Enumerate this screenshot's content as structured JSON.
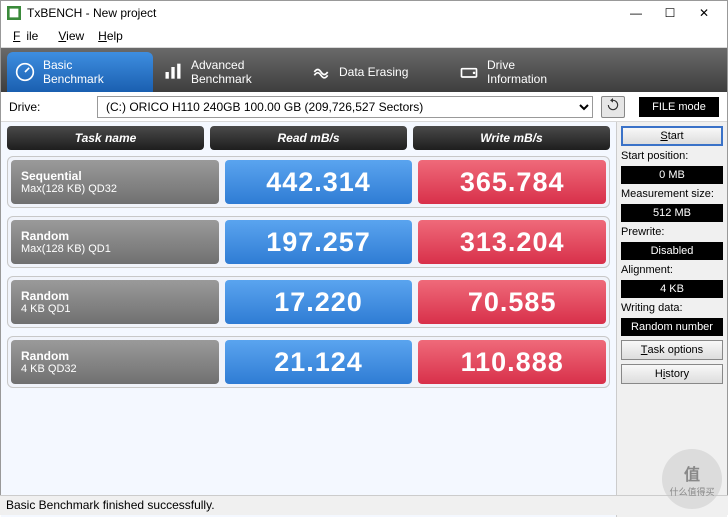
{
  "window": {
    "title": "TxBENCH - New project",
    "minimize": "—",
    "maximize": "☐",
    "close": "✕"
  },
  "menu": {
    "file": "File",
    "view": "View",
    "help": "Help"
  },
  "tabs": [
    {
      "id": "basic",
      "line1": "Basic",
      "line2": "Benchmark",
      "active": true
    },
    {
      "id": "advanced",
      "line1": "Advanced",
      "line2": "Benchmark",
      "active": false
    },
    {
      "id": "erase",
      "line1": "Data Erasing",
      "line2": "",
      "active": false
    },
    {
      "id": "drive",
      "line1": "Drive",
      "line2": "Information",
      "active": false
    }
  ],
  "drive": {
    "label": "Drive:",
    "selected": "(C:) ORICO H110 240GB  100.00 GB (209,726,527 Sectors)",
    "filemode": "FILE mode"
  },
  "headers": {
    "task": "Task name",
    "read": "Read mB/s",
    "write": "Write mB/s"
  },
  "tests": [
    {
      "name1": "Sequential",
      "name2": "Max(128 KB) QD32",
      "read": "442.314",
      "write": "365.784"
    },
    {
      "name1": "Random",
      "name2": "Max(128 KB) QD1",
      "read": "197.257",
      "write": "313.204"
    },
    {
      "name1": "Random",
      "name2": "4 KB QD1",
      "read": "17.220",
      "write": "70.585"
    },
    {
      "name1": "Random",
      "name2": "4 KB QD32",
      "read": "21.124",
      "write": "110.888"
    }
  ],
  "side": {
    "start": "Start",
    "startpos_label": "Start position:",
    "startpos": "0 MB",
    "msize_label": "Measurement size:",
    "msize": "512 MB",
    "prewrite_label": "Prewrite:",
    "prewrite": "Disabled",
    "align_label": "Alignment:",
    "align": "4 KB",
    "wdata_label": "Writing data:",
    "wdata": "Random number",
    "taskopt": "Task options",
    "history": "History"
  },
  "status": "Basic Benchmark finished successfully.",
  "watermark": {
    "big": "值",
    "small": "什么值得买"
  }
}
